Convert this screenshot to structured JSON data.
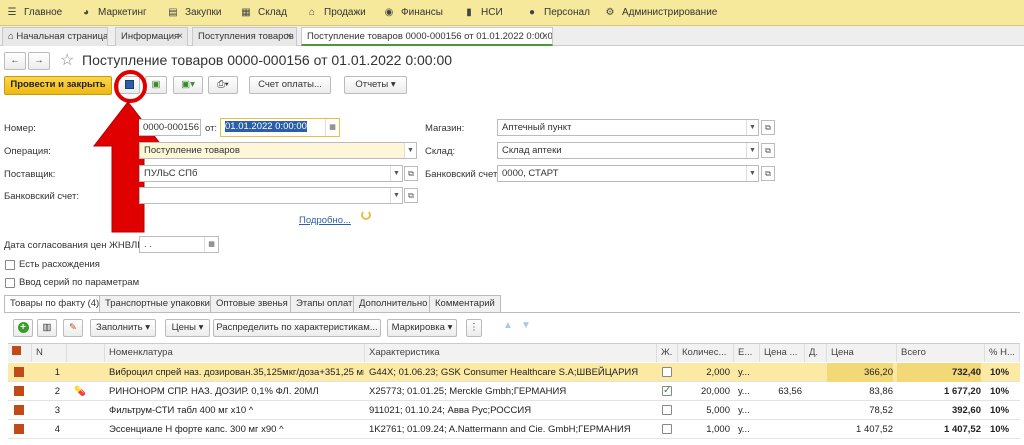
{
  "top_menu": [
    {
      "label": "Главное",
      "icon": "menu-icon"
    },
    {
      "label": "Маркетинг",
      "icon": "pie-chart-icon"
    },
    {
      "label": "Закупки",
      "icon": "cart-icon"
    },
    {
      "label": "Склад",
      "icon": "warehouse-icon"
    },
    {
      "label": "Продажи",
      "icon": "basket-icon"
    },
    {
      "label": "Финансы",
      "icon": "coins-icon"
    },
    {
      "label": "НСИ",
      "icon": "book-icon"
    },
    {
      "label": "Персонал",
      "icon": "person-icon"
    },
    {
      "label": "Администрирование",
      "icon": "gear-icon"
    }
  ],
  "tabs": [
    {
      "label": "Начальная страница",
      "icon": "home-icon"
    },
    {
      "label": "Информация",
      "close": "×"
    },
    {
      "label": "Поступления товаров",
      "close": "×"
    },
    {
      "label": "Поступление товаров 0000-000156 от 01.01.2022 0:00:00",
      "close": "×"
    }
  ],
  "header": {
    "title": "Поступление товаров 0000-000156 от 01.01.2022 0:00:00",
    "back": "←",
    "forward": "→",
    "star": "☆"
  },
  "toolbar": {
    "post_close": "Провести и закрыть",
    "invoice": "Счет оплаты...",
    "reports": "Отчеты"
  },
  "form": {
    "number_label": "Номер:",
    "number_value": "0000-000156",
    "date_label": "от:",
    "date_value": "01.01.2022  0:00:00",
    "operation_label": "Операция:",
    "operation_value": "Поступление товаров",
    "supplier_label": "Поставщик:",
    "supplier_value": "ПУЛЬС СПб",
    "bank_account_label": "Банковский счет:",
    "bank_account_value": "",
    "details_link": "Подробно...",
    "store_label": "Магазин:",
    "store_value": "Аптечный пункт",
    "warehouse_label": "Склад:",
    "warehouse_value": "Склад аптеки",
    "bank_account2_label": "Банковский счет:",
    "bank_account2_value": "0000, СТАРТ",
    "price_date_label": "Дата согласования цен ЖНВЛП:",
    "price_date_value": " .  .",
    "discrepancies_label": "Есть расхождения",
    "series_label": "Ввод серий по параметрам"
  },
  "subtabs": [
    "Товары по факту (4)",
    "Транспортные упаковки",
    "Оптовые звенья",
    "Этапы оплат",
    "Дополнительно",
    "Комментарий"
  ],
  "table_toolbar": {
    "fill": "Заполнить",
    "prices": "Цены",
    "distribute": "Распределить по характеристикам...",
    "marking": "Маркировка"
  },
  "columns": [
    "N",
    "Номенклатура",
    "Характеристика",
    "Ж.",
    "Количес...",
    "Е...",
    "Цена ...",
    "Д.",
    "Цена",
    "Всего",
    "% Н..."
  ],
  "rows": [
    {
      "n": "1",
      "name": "Виброцил спрей наз. дозирован.35,125мкг/доза+351,25 мк...",
      "char": "G44X; 01.06.23; GSK Consumer Healthcare S.A;ШВЕЙЦАРИЯ",
      "zh": false,
      "qty": "2,000",
      "unit": "у...",
      "price_in": "",
      "d": "",
      "price": "366,20",
      "total": "732,40",
      "vat": "10%"
    },
    {
      "n": "2",
      "name": "РИНОНОРМ СПР. НАЗ. ДОЗИР. 0,1% ФЛ. 20МЛ",
      "char": "X25773; 01.01.25; Merckle Gmbh;ГЕРМАНИЯ",
      "zh": true,
      "qty": "20,000",
      "unit": "у...",
      "price_in": "63,56",
      "d": "",
      "price": "83,86",
      "total": "1 677,20",
      "vat": "10%"
    },
    {
      "n": "3",
      "name": "Фильтрум-СТИ табл 400 мг х10 ^",
      "char": "911021; 01.10.24; Авва Рус;РОССИЯ",
      "zh": false,
      "qty": "5,000",
      "unit": "у...",
      "price_in": "",
      "d": "",
      "price": "78,52",
      "total": "392,60",
      "vat": "10%"
    },
    {
      "n": "4",
      "name": "Эссенциале Н форте капс. 300 мг х90 ^",
      "char": "1K2761; 01.09.24; A.Nattermann and Cie. GmbH;ГЕРМАНИЯ",
      "zh": false,
      "qty": "1,000",
      "unit": "у...",
      "price_in": "",
      "d": "",
      "price": "1 407,52",
      "total": "1 407,52",
      "vat": "10%"
    }
  ],
  "colors": {
    "menu_bg": "#f7e99c",
    "accent_green": "#4a9a3c",
    "post_button": "#f0b810",
    "annotation_red": "#e00000"
  }
}
